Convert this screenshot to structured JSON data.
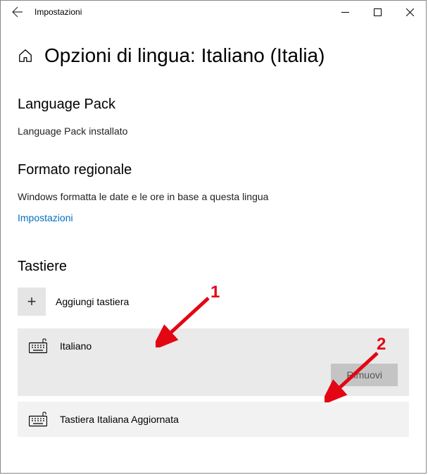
{
  "titlebar": {
    "app_name": "Impostazioni"
  },
  "header": {
    "title": "Opzioni di lingua: Italiano (Italia)"
  },
  "language_pack": {
    "heading": "Language Pack",
    "status": "Language Pack installato"
  },
  "regional_format": {
    "heading": "Formato regionale",
    "description": "Windows formatta le date e le ore in base a questa lingua",
    "link": "Impostazioni"
  },
  "keyboards": {
    "heading": "Tastiere",
    "add_label": "Aggiungi tastiera",
    "items": [
      {
        "label": "Italiano",
        "remove_label": "Rimuovi"
      },
      {
        "label": "Tastiera Italiana Aggiornata"
      }
    ]
  },
  "annotations": {
    "one": "1",
    "two": "2"
  }
}
